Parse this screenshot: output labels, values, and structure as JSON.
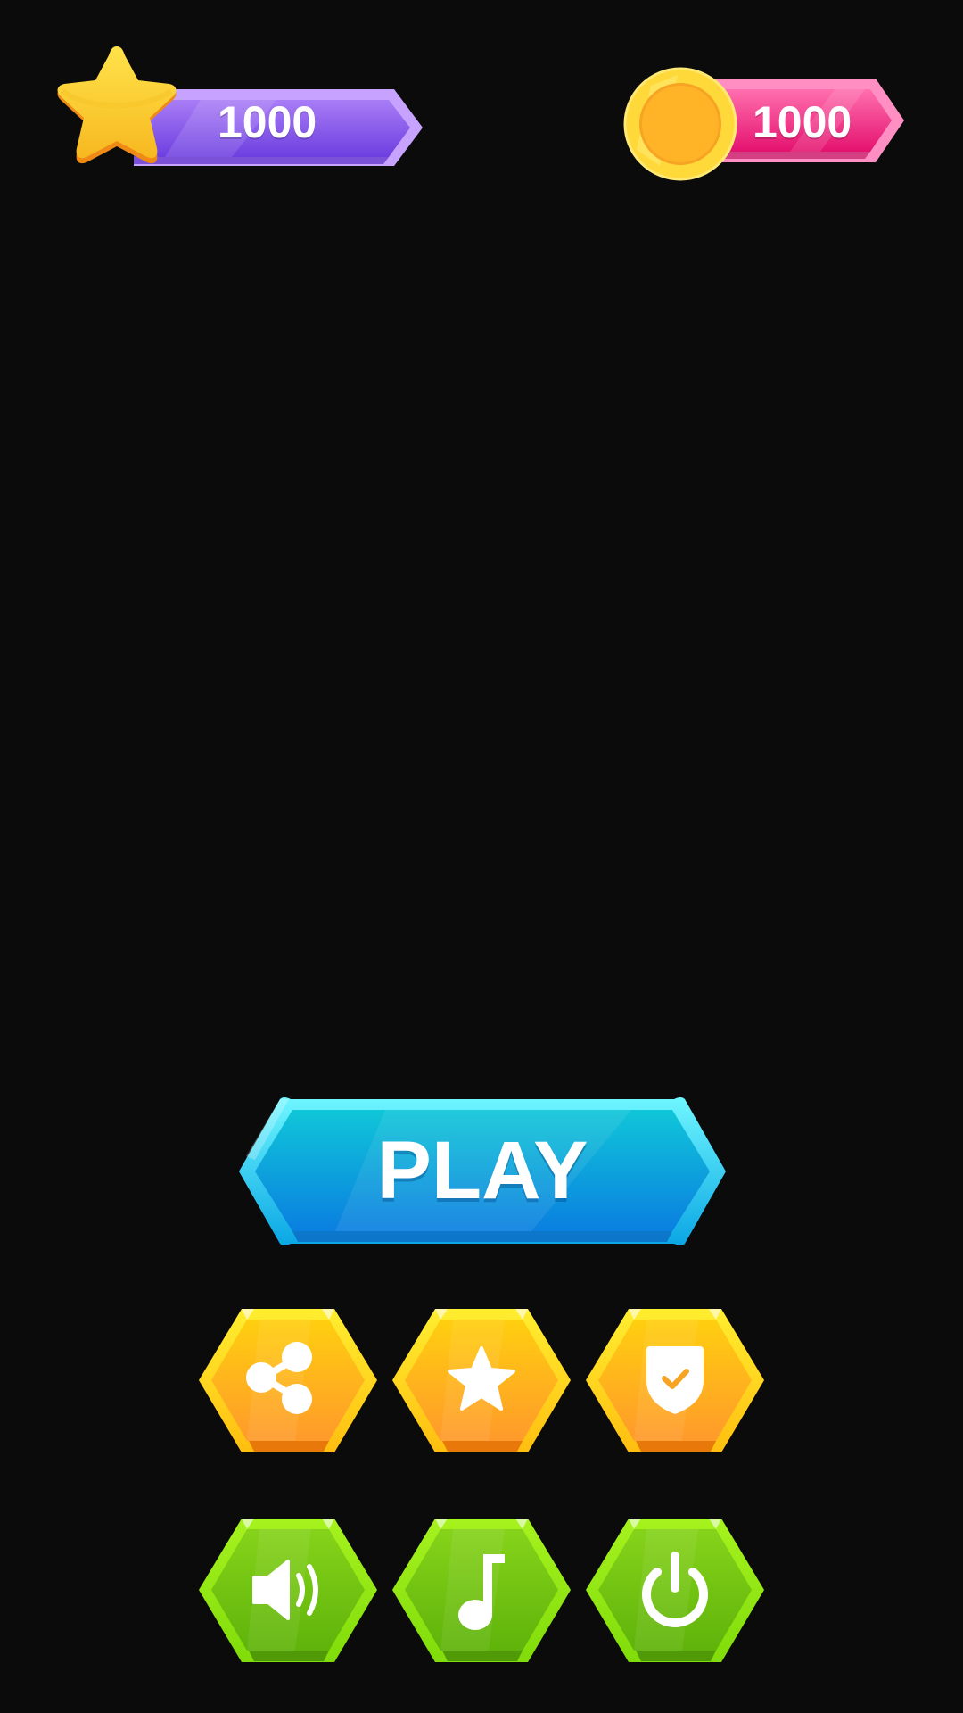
{
  "hud": {
    "stars": {
      "value": "1000",
      "icon": "star-icon",
      "color": "#7b48e8"
    },
    "coins": {
      "value": "1000",
      "icon": "coin-icon",
      "color": "#f0197a"
    }
  },
  "play_button": {
    "label": "PLAY",
    "color": "#0a8fe0"
  },
  "menu_row_1": [
    {
      "icon": "share-icon",
      "color": "#ffa71a"
    },
    {
      "icon": "star-icon",
      "color": "#ffa71a"
    },
    {
      "icon": "shield-check-icon",
      "color": "#ffa71a"
    }
  ],
  "menu_row_2": [
    {
      "icon": "sound-icon",
      "color": "#6cc40a"
    },
    {
      "icon": "music-note-icon",
      "color": "#6cc40a"
    },
    {
      "icon": "power-icon",
      "color": "#6cc40a"
    }
  ]
}
